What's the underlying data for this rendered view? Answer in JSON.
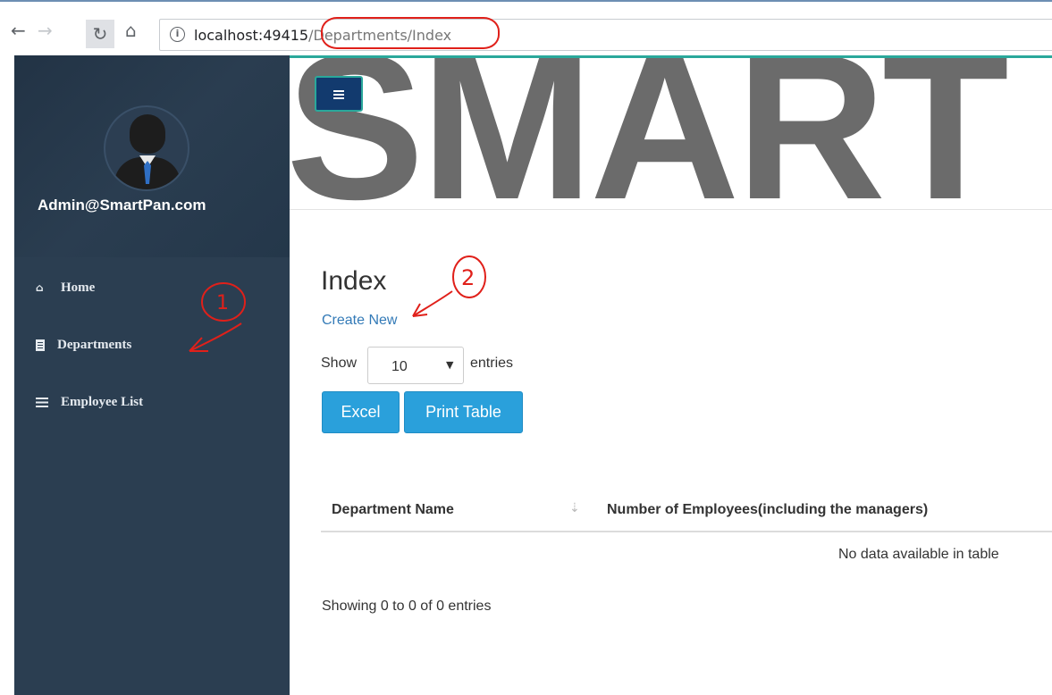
{
  "browser": {
    "url_host": "localhost:49415",
    "url_path": "/Departments/Index"
  },
  "sidebar": {
    "user_email": "Admin@SmartPan.com",
    "items": [
      {
        "label": "Home",
        "icon": "home-icon"
      },
      {
        "label": "Departments",
        "icon": "building-icon"
      },
      {
        "label": "Employee List",
        "icon": "list-icon"
      }
    ]
  },
  "banner": {
    "text": "SMART"
  },
  "main": {
    "title": "Index",
    "create_link": "Create New",
    "length_menu": {
      "prefix": "Show",
      "value": "10",
      "suffix": "entries"
    },
    "buttons": {
      "excel": "Excel",
      "print": "Print Table"
    },
    "table": {
      "columns": [
        "Department Name",
        "Number of Employees(including the managers)"
      ],
      "empty_message": "No data available in table"
    },
    "info": "Showing 0 to 0 of 0 entries"
  },
  "annotations": {
    "one": "1",
    "two": "2"
  },
  "colors": {
    "sidebar_bg": "#2b3e51",
    "accent": "#2aa0db",
    "link": "#337ab7",
    "annotation": "#e0201a"
  }
}
